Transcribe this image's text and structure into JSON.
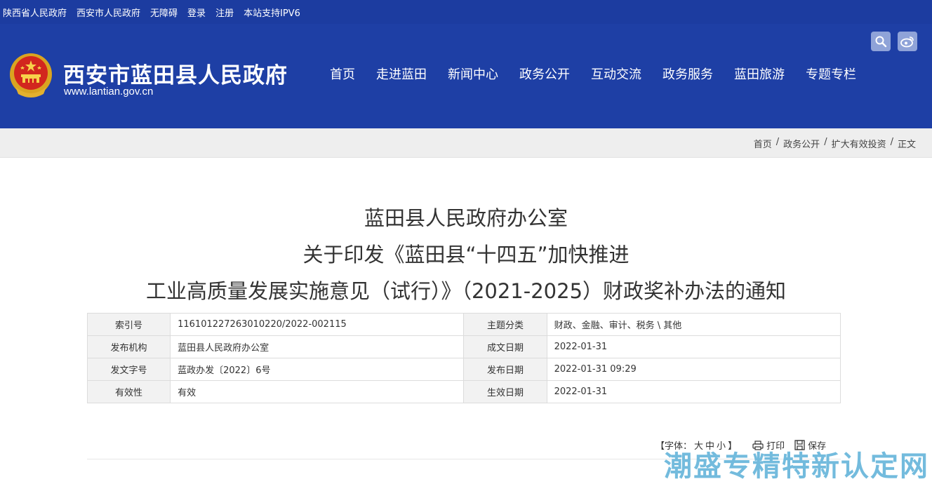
{
  "topbar": {
    "links": [
      "陕西省人民政府",
      "西安市人民政府",
      "无障碍",
      "登录",
      "注册",
      "本站支持IPV6"
    ]
  },
  "header": {
    "site_title": "西安市蓝田县人民政府",
    "site_url": "www.lantian.gov.cn",
    "nav": [
      "首页",
      "走进蓝田",
      "新闻中心",
      "政务公开",
      "互动交流",
      "政务服务",
      "蓝田旅游",
      "专题专栏"
    ],
    "icons": [
      "search-icon",
      "weibo-icon"
    ]
  },
  "breadcrumb": {
    "items": [
      "首页",
      "政务公开",
      "扩大有效投资",
      "正文"
    ],
    "separator": "/"
  },
  "document": {
    "title_lines": [
      "蓝田县人民政府办公室",
      "关于印发《蓝田县“十四五”加快推进",
      "工业高质量发展实施意见（试行）》（2021-2025）财政奖补办法的通知"
    ]
  },
  "meta": {
    "rows": [
      {
        "k1": "索引号",
        "v1": "116101227263010220/2022-002115",
        "k2": "主题分类",
        "v2": "财政、金融、审计、税务 \\ 其他"
      },
      {
        "k1": "发布机构",
        "v1": "蓝田县人民政府办公室",
        "k2": "成文日期",
        "v2": "2022-01-31"
      },
      {
        "k1": "发文字号",
        "v1": "蓝政办发〔2022〕6号",
        "k2": "发布日期",
        "v2": "2022-01-31 09:29"
      },
      {
        "k1": "有效性",
        "v1": "有效",
        "k2": "生效日期",
        "v2": "2022-01-31"
      }
    ]
  },
  "tools": {
    "font_label_open": "【字体：",
    "font_large": "大",
    "font_medium": "中",
    "font_small": "小",
    "font_label_close": "】",
    "print": "打印",
    "save": "保存"
  },
  "watermark": "潮盛专精特新认定网",
  "colors": {
    "header_bg": "#1e3fa5",
    "topbar_bg": "#1c3ca0",
    "crumb_bg": "#eeeeee",
    "watermark": "#5bb0d8"
  }
}
